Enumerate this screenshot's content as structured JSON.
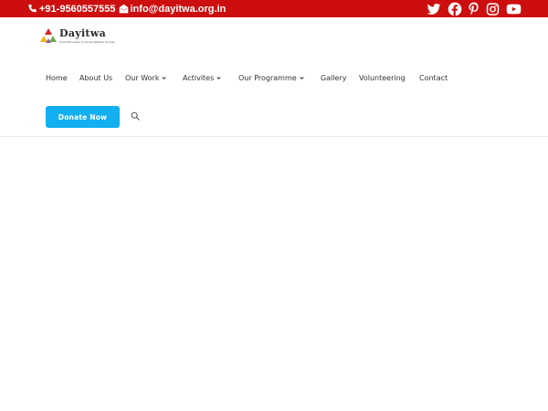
{
  "topbar": {
    "phone": "+91-9560557555",
    "email": "info@dayitwa.org.in",
    "background_color": "#cd0e0e",
    "social_icons": [
      "twitter-icon",
      "facebook-icon",
      "pinterest-icon",
      "instagram-icon",
      "youtube-icon"
    ]
  },
  "logo": {
    "name": "Dayitwa",
    "tagline": "Child Education & Social Welfare Society"
  },
  "nav": {
    "items": [
      {
        "label": "Home",
        "has_dropdown": false
      },
      {
        "label": "About Us",
        "has_dropdown": false
      },
      {
        "label": "Our Work",
        "has_dropdown": true
      },
      {
        "label": "Activites",
        "has_dropdown": true
      },
      {
        "label": "Our Programme",
        "has_dropdown": true
      },
      {
        "label": "Gallery",
        "has_dropdown": false
      },
      {
        "label": "Volunteering",
        "has_dropdown": false
      },
      {
        "label": "Contact",
        "has_dropdown": false
      }
    ]
  },
  "donate": {
    "label": "Donate Now",
    "color": "#13aff0"
  }
}
